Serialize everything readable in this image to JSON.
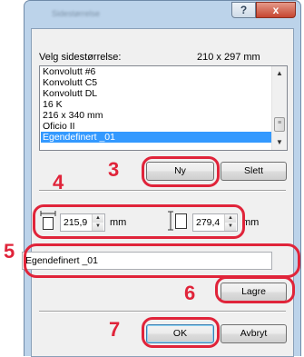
{
  "window": {
    "title": "Sidestørrelse",
    "help_label": "?",
    "close_label": "x"
  },
  "size_section": {
    "label": "Velg sidestørrelse:",
    "current_size": "210 x 297 mm"
  },
  "paper_list": {
    "items": [
      {
        "label": "Konvolutt #6"
      },
      {
        "label": "Konvolutt C5"
      },
      {
        "label": "Konvolutt DL"
      },
      {
        "label": "16 K"
      },
      {
        "label": "216 x 340 mm"
      },
      {
        "label": "Oficio II"
      },
      {
        "label": "Egendefinert _01"
      }
    ],
    "selected_index": 6
  },
  "buttons": {
    "new": "Ny",
    "delete": "Slett",
    "save": "Lagre",
    "ok": "OK",
    "cancel": "Avbryt"
  },
  "dimensions": {
    "width_value": "215,9",
    "width_unit": "mm",
    "height_value": "279,4",
    "height_unit": "mm"
  },
  "name_field": {
    "value": "Egendefinert _01"
  },
  "callouts": [
    "3",
    "4",
    "5",
    "6",
    "7"
  ],
  "colors": {
    "callout": "#e0243a",
    "selection": "#3399ff",
    "frame": "#bcd3ea"
  }
}
